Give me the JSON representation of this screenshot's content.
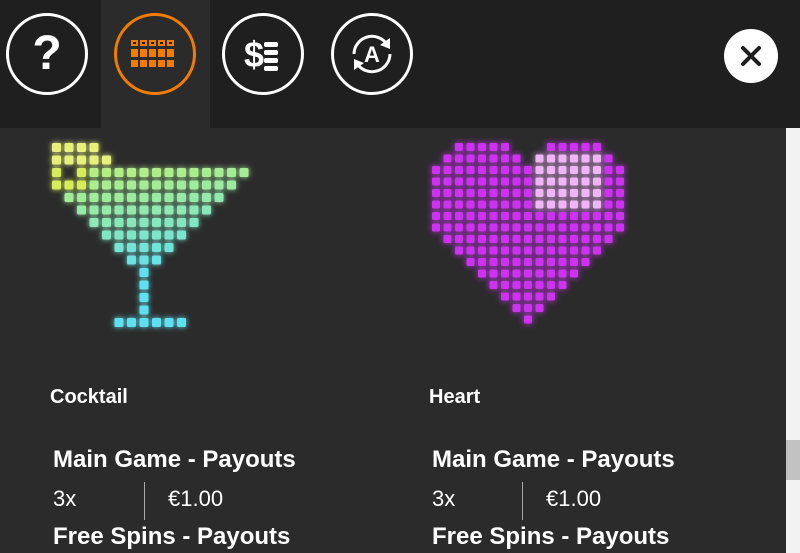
{
  "toolbar": {
    "buttons": [
      {
        "name": "help",
        "icon": "question-mark-icon"
      },
      {
        "name": "paytable",
        "icon": "grid-icon",
        "active": true
      },
      {
        "name": "bet-settings",
        "icon": "dollar-coins-icon"
      },
      {
        "name": "autoplay",
        "icon": "autoplay-a-icon",
        "glyph": "A"
      }
    ],
    "help_glyph": "?",
    "accent_color": "#f07d00",
    "close_icon": "close-x-icon"
  },
  "symbols": [
    {
      "name": "Cocktail",
      "icon": "cocktail-glass-icon",
      "main_game_title": "Main Game - Payouts",
      "payouts": [
        {
          "multiplier": "3x",
          "amount": "€1.00"
        }
      ],
      "free_spins_title": "Free Spins - Payouts"
    },
    {
      "name": "Heart",
      "icon": "heart-icon",
      "main_game_title": "Main Game - Payouts",
      "payouts": [
        {
          "multiplier": "3x",
          "amount": "€1.00"
        }
      ],
      "free_spins_title": "Free Spins - Payouts"
    }
  ]
}
